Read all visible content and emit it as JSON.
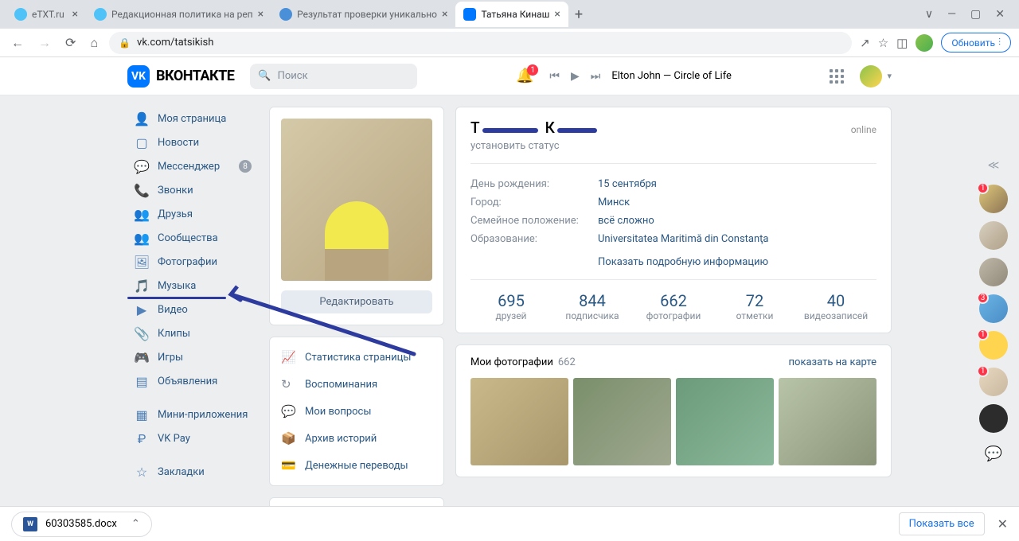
{
  "browser": {
    "tabs": [
      {
        "title": "eTXT.ru",
        "active": false
      },
      {
        "title": "Редакционная политика на реп",
        "active": false
      },
      {
        "title": "Результат проверки уникально",
        "active": false
      },
      {
        "title": "Татьяна Кинаш",
        "active": true
      }
    ],
    "url": "vk.com/tatsikish",
    "update_btn": "Обновить"
  },
  "vk": {
    "logo_text": "ВКОНТАКТЕ",
    "search_placeholder": "Поиск",
    "notif_count": "1",
    "now_playing": "Elton John — Circle of Life"
  },
  "nav": {
    "items": [
      {
        "label": "Моя страница"
      },
      {
        "label": "Новости"
      },
      {
        "label": "Мессенджер",
        "badge": "8"
      },
      {
        "label": "Звонки"
      },
      {
        "label": "Друзья"
      },
      {
        "label": "Сообщества"
      },
      {
        "label": "Фотографии"
      },
      {
        "label": "Музыка"
      },
      {
        "label": "Видео"
      },
      {
        "label": "Клипы"
      },
      {
        "label": "Игры"
      },
      {
        "label": "Объявления"
      }
    ],
    "items2": [
      {
        "label": "Мини-приложения"
      },
      {
        "label": "VK Pay"
      }
    ],
    "items3": [
      {
        "label": "Закладки"
      }
    ]
  },
  "center": {
    "edit_btn": "Редактировать",
    "tools": [
      {
        "label": "Статистика страницы"
      },
      {
        "label": "Воспоминания"
      },
      {
        "label": "Мои вопросы"
      },
      {
        "label": "Архив историй"
      },
      {
        "label": "Денежные переводы"
      }
    ]
  },
  "profile": {
    "online": "online",
    "status": "установить статус",
    "info": [
      {
        "label": "День рождения:",
        "value": "15 сентября"
      },
      {
        "label": "Город:",
        "value": "Минск"
      },
      {
        "label": "Семейное положение:",
        "value": "всё сложно"
      },
      {
        "label": "Образование:",
        "value": "Universitatea Maritimă din Constanţa"
      }
    ],
    "show_more": "Показать подробную информацию",
    "stats": [
      {
        "num": "695",
        "label": "друзей"
      },
      {
        "num": "844",
        "label": "подписчика"
      },
      {
        "num": "662",
        "label": "фотографии"
      },
      {
        "num": "72",
        "label": "отметки"
      },
      {
        "num": "40",
        "label": "видеозаписей"
      }
    ]
  },
  "photos": {
    "title": "Мои фотографии",
    "count": "662",
    "map_link": "показать на карте"
  },
  "contacts": {
    "badges": [
      "1",
      "",
      "",
      "3",
      "1",
      "1",
      ""
    ]
  },
  "download": {
    "file": "60303585.docx",
    "show_all": "Показать все"
  }
}
